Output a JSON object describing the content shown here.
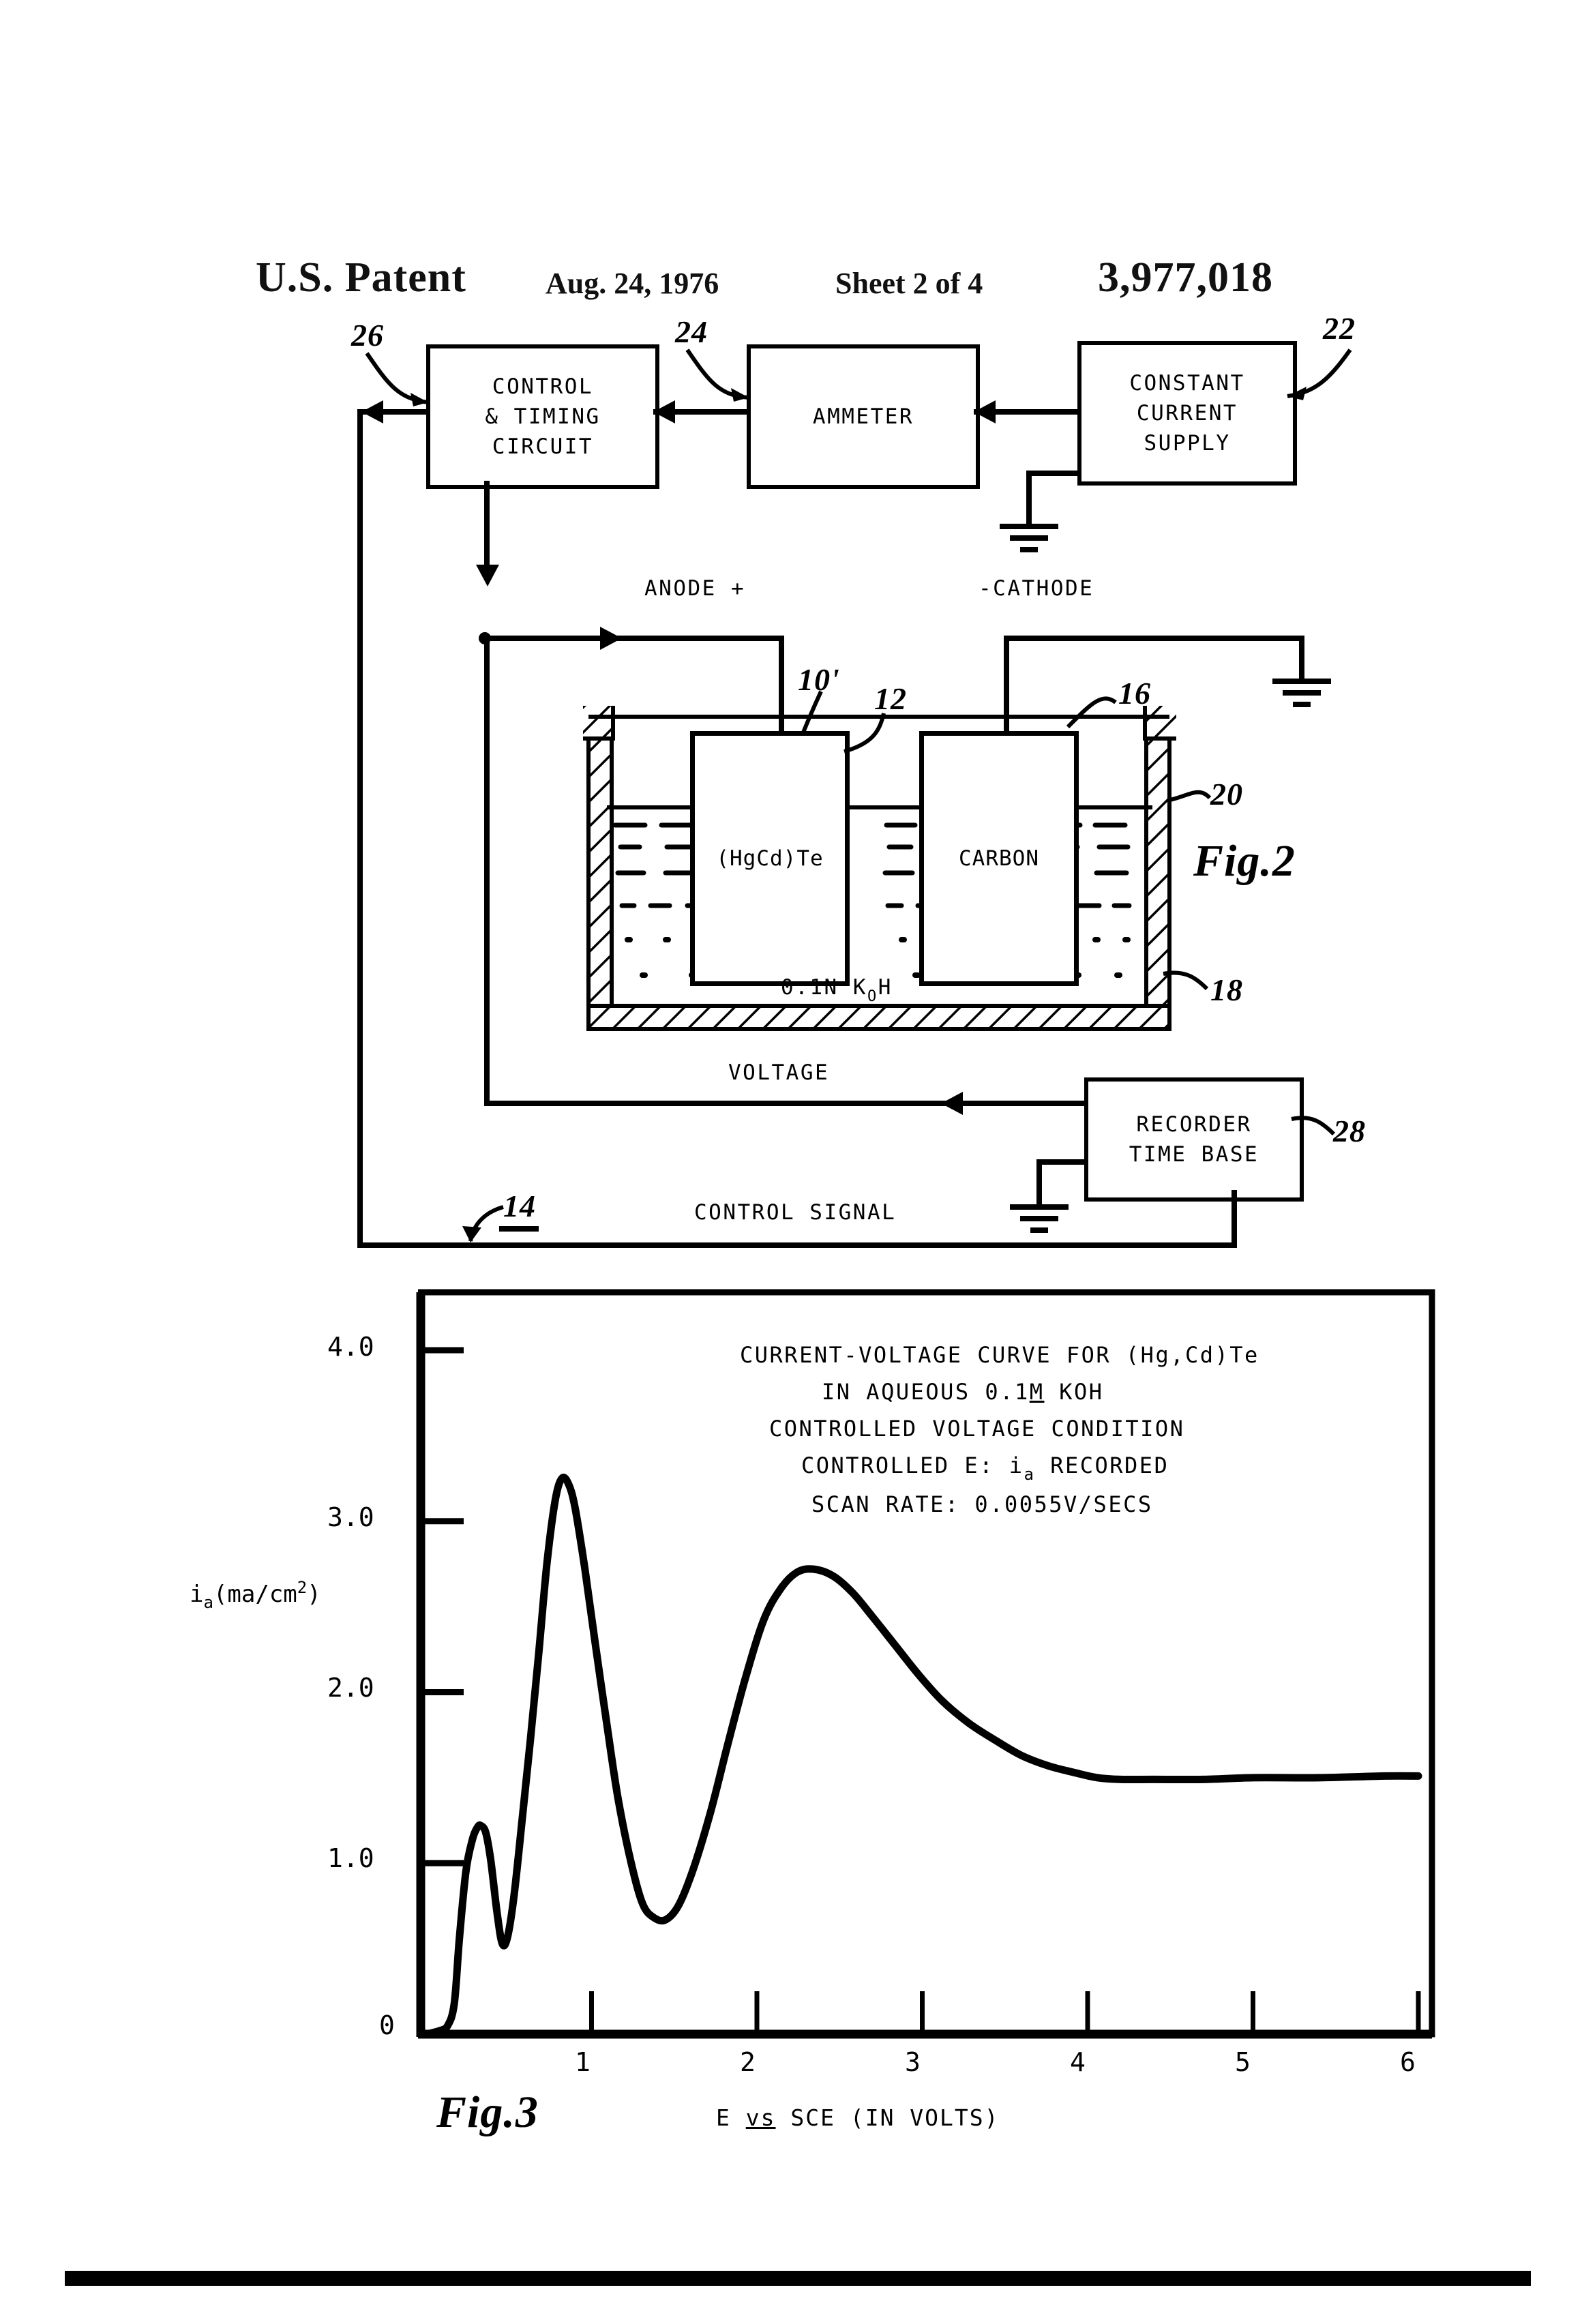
{
  "header": {
    "office": "U.S. Patent",
    "date": "Aug. 24, 1976",
    "sheet": "Sheet 2 of 4",
    "patent_number": "3,977,018"
  },
  "figure2": {
    "caption": "Fig.2",
    "blocks": [
      {
        "id": "control",
        "lines": [
          "CONTROL",
          "& TIMING",
          "CIRCUIT"
        ],
        "ref": "26"
      },
      {
        "id": "ammeter",
        "lines": [
          "AMMETER"
        ],
        "ref": "24"
      },
      {
        "id": "supply",
        "lines": [
          "CONSTANT",
          "CURRENT",
          "SUPPLY"
        ],
        "ref": "22"
      },
      {
        "id": "recorder",
        "lines": [
          "RECORDER",
          "TIME BASE"
        ],
        "ref": "28"
      }
    ],
    "labels": {
      "anode": "ANODE +",
      "cathode": "-CATHODE",
      "voltage": "VOLTAGE",
      "control_signal": "CONTROL SIGNAL",
      "electrolyte": "0.1N K",
      "electrolyte_sub": "O",
      "electrolyte_tail": "H"
    },
    "cell": {
      "anode_electrode": "(HgCd)Te",
      "cathode_electrode": "CARBON",
      "ref_anode": "10'",
      "ref_anode_lead": "12",
      "ref_cathode_lead": "16",
      "ref_electrolyte": "20",
      "ref_vessel": "18"
    },
    "system_ref": "14"
  },
  "figure3": {
    "caption": "Fig.3",
    "chart_data": {
      "type": "line",
      "title": "CURRENT-VOLTAGE CURVE FOR (Hg,Cd)Te",
      "subtitle_lines": [
        "IN AQUEOUS 0.1M KOH",
        "CONTROLLED VOLTAGE CONDITION",
        "CONTROLLED E: i RECORDED",
        "SCAN RATE:  0.0055V/SECS"
      ],
      "title_line2_pre": "IN AQUEOUS 0.1",
      "title_line2_underlined": "M",
      "title_line2_post": " KOH",
      "title_line4_pre": "CONTROLLED E: i",
      "title_line4_sub": "a",
      "title_line4_post": " RECORDED",
      "title_line5": "SCAN RATE:  0.0055V/SECS",
      "xlabel_pre": "E ",
      "xlabel_underlined": "vs",
      "xlabel_post": " SCE (IN VOLTS)",
      "ylabel_pre": "i",
      "ylabel_sub": "a",
      "ylabel_post": "(ma/cm",
      "ylabel_sup": "2",
      "ylabel_tail": ")",
      "xlim": [
        0,
        6
      ],
      "ylim": [
        0,
        4.2
      ],
      "xticks": [
        0,
        1,
        2,
        3,
        4,
        5,
        6
      ],
      "xticklabels": [
        "0",
        "1",
        "2",
        "3",
        "4",
        "5",
        "6"
      ],
      "yticks": [
        1.0,
        2.0,
        3.0,
        4.0
      ],
      "yticklabels": [
        "1.0",
        "2.0",
        "3.0",
        "4.0"
      ],
      "grid": false,
      "legend": "none",
      "x": [
        0.0,
        0.08,
        0.13,
        0.17,
        0.2,
        0.24,
        0.28,
        0.31,
        0.33,
        0.36,
        0.39,
        0.43,
        0.46,
        0.49,
        0.53,
        0.58,
        0.63,
        0.68,
        0.73,
        0.78,
        0.82,
        0.86,
        0.9,
        0.96,
        1.02,
        1.09,
        1.16,
        1.24,
        1.31,
        1.38,
        1.45,
        1.53,
        1.62,
        1.72,
        1.82,
        1.93,
        2.04,
        2.14,
        2.24,
        2.34,
        2.46,
        2.58,
        2.7,
        2.84,
        2.98,
        3.12,
        3.28,
        3.44,
        3.6,
        3.76,
        3.92,
        4.06,
        4.2,
        4.4,
        4.7,
        5.0,
        5.4,
        5.8,
        6.0
      ],
      "y": [
        0.0,
        0.02,
        0.05,
        0.18,
        0.55,
        0.95,
        1.14,
        1.21,
        1.22,
        1.18,
        1.02,
        0.7,
        0.53,
        0.56,
        0.8,
        1.25,
        1.72,
        2.22,
        2.75,
        3.12,
        3.25,
        3.22,
        3.08,
        2.72,
        2.3,
        1.83,
        1.38,
        1.0,
        0.76,
        0.68,
        0.67,
        0.76,
        0.98,
        1.3,
        1.68,
        2.08,
        2.42,
        2.6,
        2.7,
        2.72,
        2.68,
        2.58,
        2.44,
        2.27,
        2.1,
        1.95,
        1.82,
        1.72,
        1.63,
        1.57,
        1.53,
        1.5,
        1.49,
        1.49,
        1.49,
        1.5,
        1.5,
        1.51,
        1.51
      ]
    }
  }
}
